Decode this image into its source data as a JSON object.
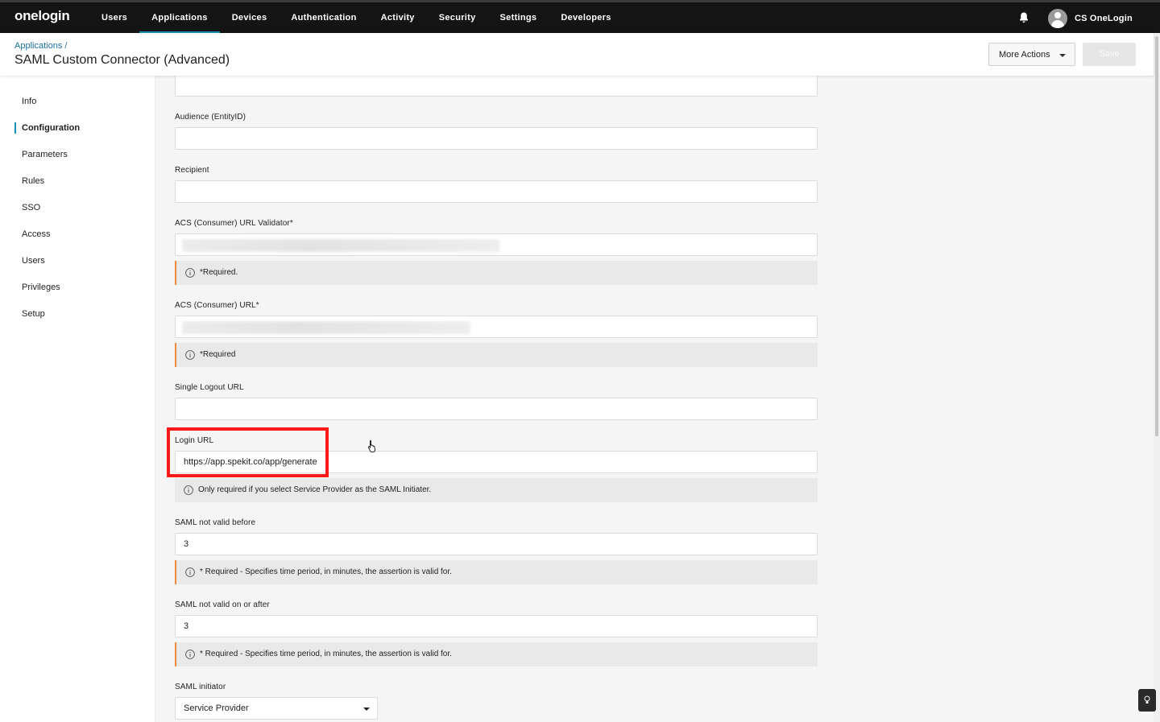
{
  "topbar": {
    "logo": "onelogin",
    "nav": [
      "Users",
      "Applications",
      "Devices",
      "Authentication",
      "Activity",
      "Security",
      "Settings",
      "Developers"
    ],
    "active_nav": "Applications",
    "user_name": "CS OneLogin"
  },
  "header": {
    "breadcrumb": "Applications /",
    "title": "SAML Custom Connector (Advanced)",
    "more_actions": "More Actions",
    "save": "Save"
  },
  "sidebar": {
    "items": [
      "Info",
      "Configuration",
      "Parameters",
      "Rules",
      "SSO",
      "Access",
      "Users",
      "Privileges",
      "Setup"
    ],
    "active": "Configuration"
  },
  "form": {
    "audience_label": "Audience (EntityID)",
    "audience_value": "",
    "recipient_label": "Recipient",
    "recipient_value": "",
    "acs_validator_label": "ACS (Consumer) URL Validator*",
    "acs_validator_note": "*Required.",
    "acs_url_label": "ACS (Consumer) URL*",
    "acs_url_note": "*Required",
    "logout_label": "Single Logout URL",
    "logout_value": "",
    "login_url_label": "Login URL",
    "login_url_value": "https://app.spekit.co/app/generate",
    "login_url_note": "Only required if you select Service Provider as the SAML Initiater.",
    "not_before_label": "SAML not valid before",
    "not_before_value": "3",
    "not_before_note": "* Required - Specifies time period, in minutes, the assertion is valid for.",
    "not_after_label": "SAML not valid on or after",
    "not_after_value": "3",
    "not_after_note": "* Required - Specifies time period, in minutes, the assertion is valid for.",
    "initiator_label": "SAML initiator",
    "initiator_value": "Service Provider"
  },
  "colors": {
    "accent": "#1a91b8",
    "required_border": "#ef8a3c",
    "highlight": "#ff1a1a",
    "topbar": "#141414"
  }
}
